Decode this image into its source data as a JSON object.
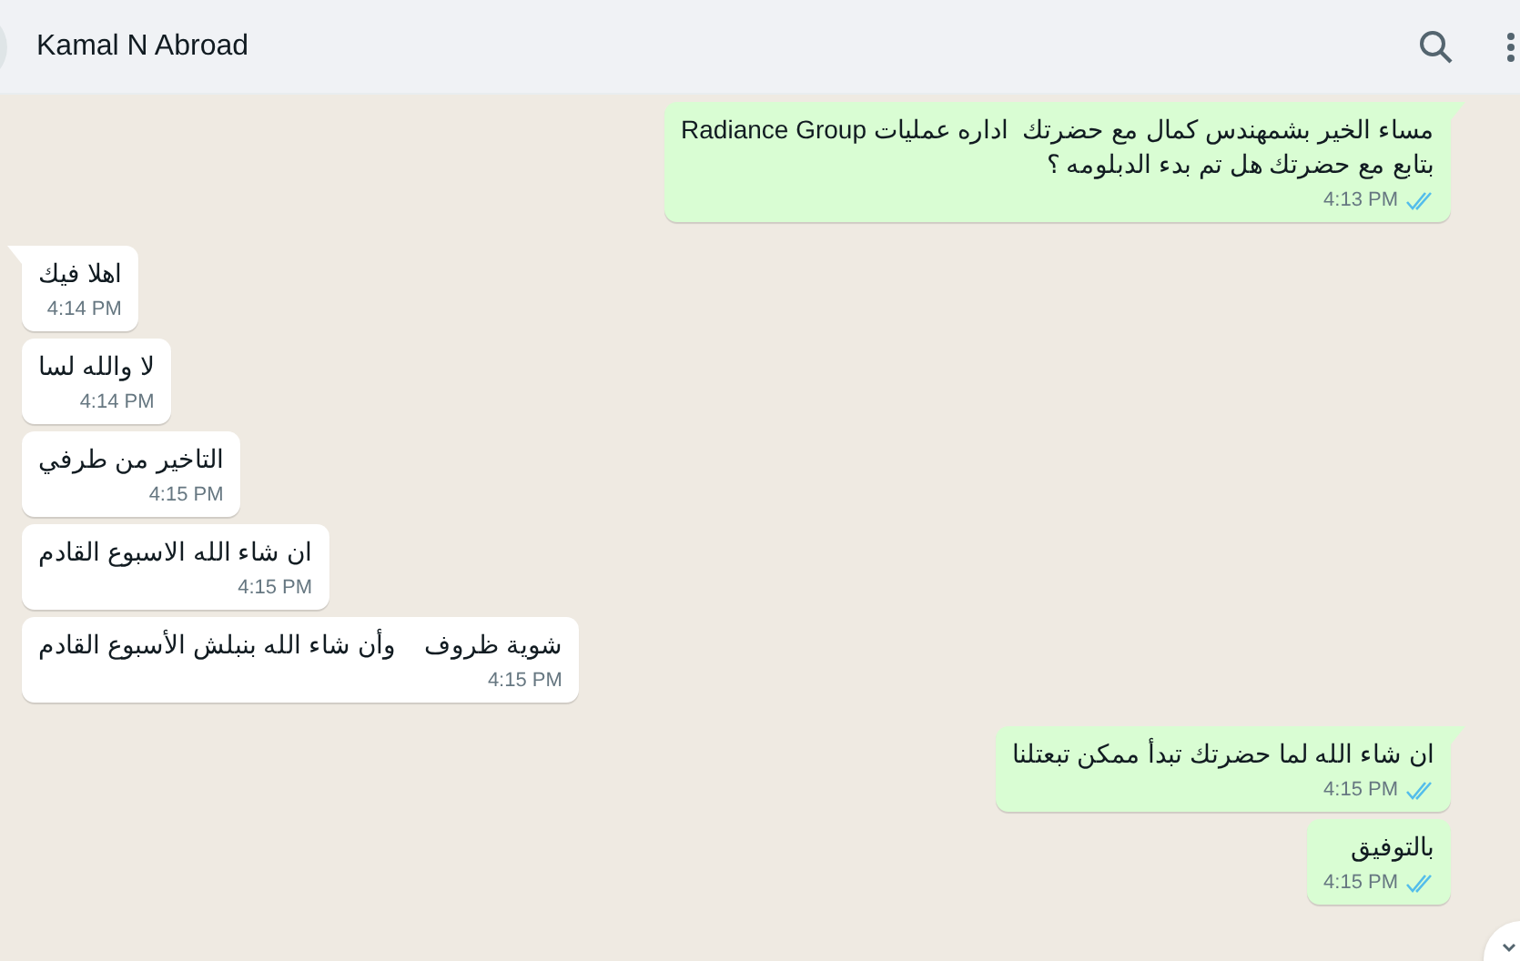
{
  "header": {
    "contact_name": "Kamal N Abroad"
  },
  "messages": [
    {
      "outgoing": true,
      "tail": true,
      "lines": [
        "مساء الخير بشمهندس كمال مع حضرتك  اداره عمليات Radiance Group",
        "بتابع مع حضرتك هل تم بدء الدبلومه ؟"
      ],
      "time": "4:13 PM",
      "read": true
    },
    {
      "outgoing": false,
      "tail": true,
      "lines": [
        "اهلا فيك"
      ],
      "time": "4:14 PM"
    },
    {
      "outgoing": false,
      "tail": false,
      "lines": [
        "لا والله لسا"
      ],
      "time": "4:14 PM"
    },
    {
      "outgoing": false,
      "tail": false,
      "lines": [
        "التاخير من طرفي"
      ],
      "time": "4:15 PM"
    },
    {
      "outgoing": false,
      "tail": false,
      "lines": [
        "ان شاء الله الاسبوع القادم"
      ],
      "time": "4:15 PM"
    },
    {
      "outgoing": false,
      "tail": false,
      "lines": [
        "شوية ظروف    وأن شاء الله بنبلش الأسبوع القادم"
      ],
      "time": "4:15 PM"
    },
    {
      "outgoing": true,
      "tail": true,
      "lines": [
        "ان شاء الله لما حضرتك تبدأ ممكن تبعتلنا"
      ],
      "time": "4:15 PM",
      "read": true
    },
    {
      "outgoing": true,
      "tail": false,
      "lines": [
        "بالتوفيق"
      ],
      "time": "4:15 PM",
      "read": true
    }
  ]
}
